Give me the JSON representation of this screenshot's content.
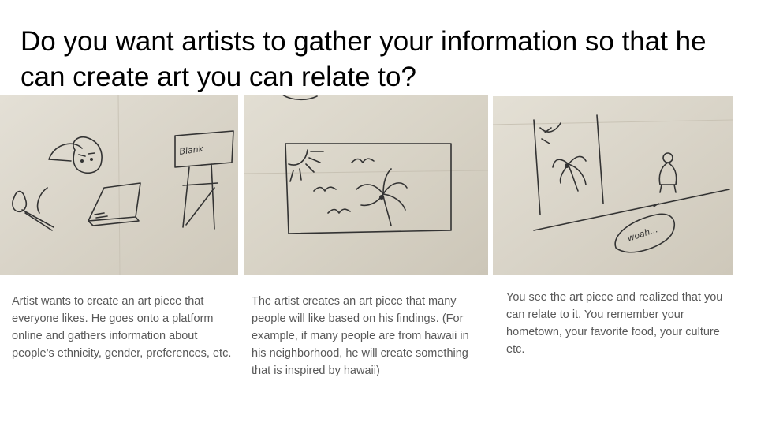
{
  "slide": {
    "title": "Do you want artists to gather your information so that he can create art you can relate to?"
  },
  "panels": [
    {
      "sketch_label": "Blank",
      "caption": "Artist wants to create an art piece that everyone likes. He goes onto a platform online and gathers information about people’s ethnicity, gender, preferences, etc."
    },
    {
      "caption": "The artist creates an art piece that many people will like based on his findings. (For example, if many people are from hawaii in his neighborhood, he will create something that is inspired by hawaii)"
    },
    {
      "sketch_label": "woah...",
      "caption": "You see the art piece and realized that you can relate to it. You remember your hometown, your favorite food, your culture etc."
    }
  ]
}
